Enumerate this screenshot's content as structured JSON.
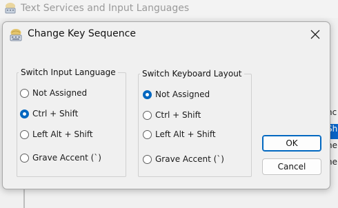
{
  "background_window": {
    "title": "Text Services and Input Languages",
    "right_strip": [
      "nc",
      "Shi",
      "ne",
      "ne"
    ]
  },
  "dialog": {
    "title": "Change Key Sequence",
    "input_language_group": {
      "legend": "Switch Input Language",
      "options": [
        {
          "label": "Not Assigned",
          "checked": false
        },
        {
          "label": "Ctrl + Shift",
          "checked": true
        },
        {
          "label": "Left Alt + Shift",
          "checked": false
        },
        {
          "label": "Grave Accent (`)",
          "checked": false
        }
      ]
    },
    "keyboard_layout_group": {
      "legend": "Switch Keyboard Layout",
      "options": [
        {
          "label": "Not Assigned",
          "checked": true
        },
        {
          "label": "Ctrl + Shift",
          "checked": false
        },
        {
          "label": "Left Alt + Shift",
          "checked": false
        },
        {
          "label": "Grave Accent (`)",
          "checked": false
        }
      ]
    },
    "ok_label": "OK",
    "cancel_label": "Cancel"
  },
  "colors": {
    "accent": "#0067c0",
    "selected_row": "#0a64c8"
  }
}
